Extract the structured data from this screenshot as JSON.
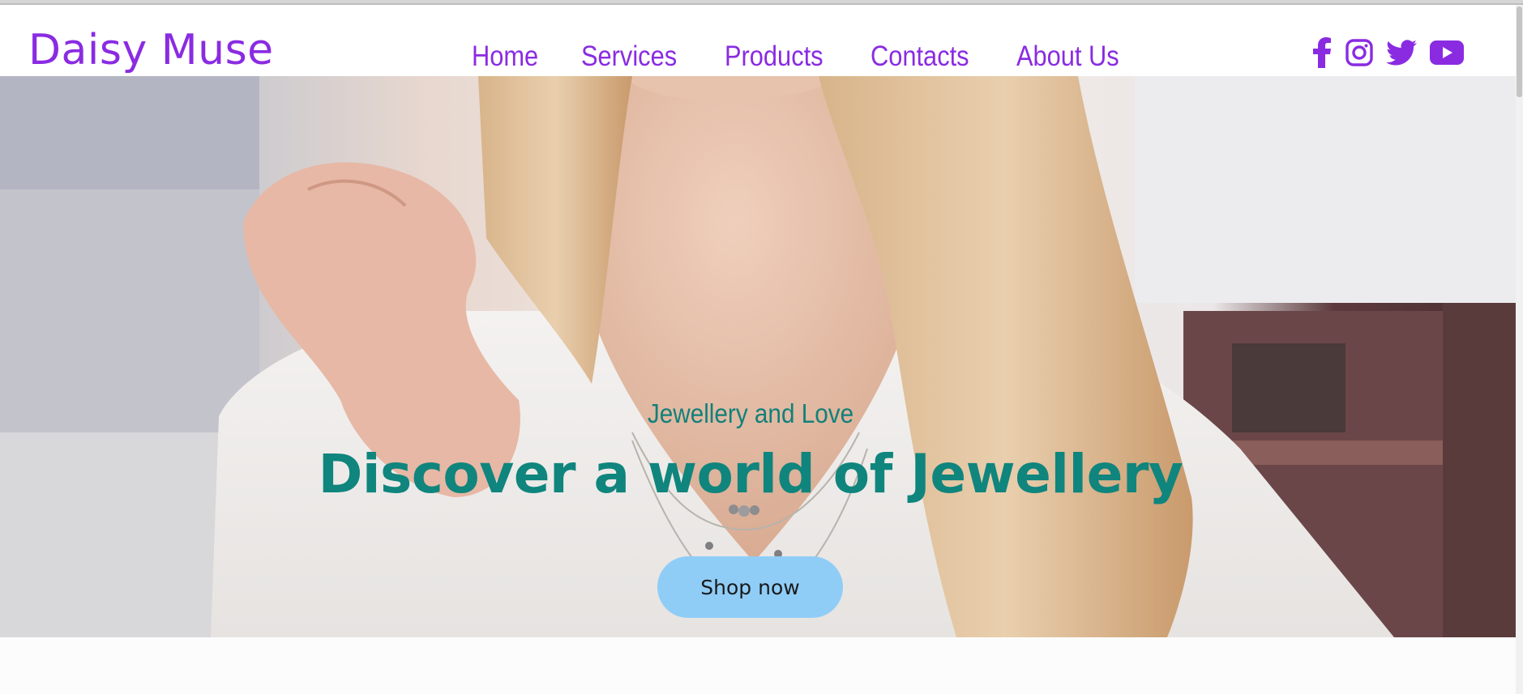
{
  "brand": {
    "name": "Daisy Muse"
  },
  "nav": {
    "items": [
      "Home",
      "Services",
      "Products",
      "Contacts",
      "About Us"
    ]
  },
  "social": {
    "icons": [
      "facebook-icon",
      "instagram-icon",
      "twitter-icon",
      "youtube-icon"
    ]
  },
  "hero": {
    "subtitle": "Jewellery and Love",
    "title": "Discover a world of Jewellery",
    "cta_label": "Shop now"
  },
  "colors": {
    "brand": "#8a2be2",
    "hero_text": "#0f857d",
    "cta_background": "#8fcdf7"
  }
}
